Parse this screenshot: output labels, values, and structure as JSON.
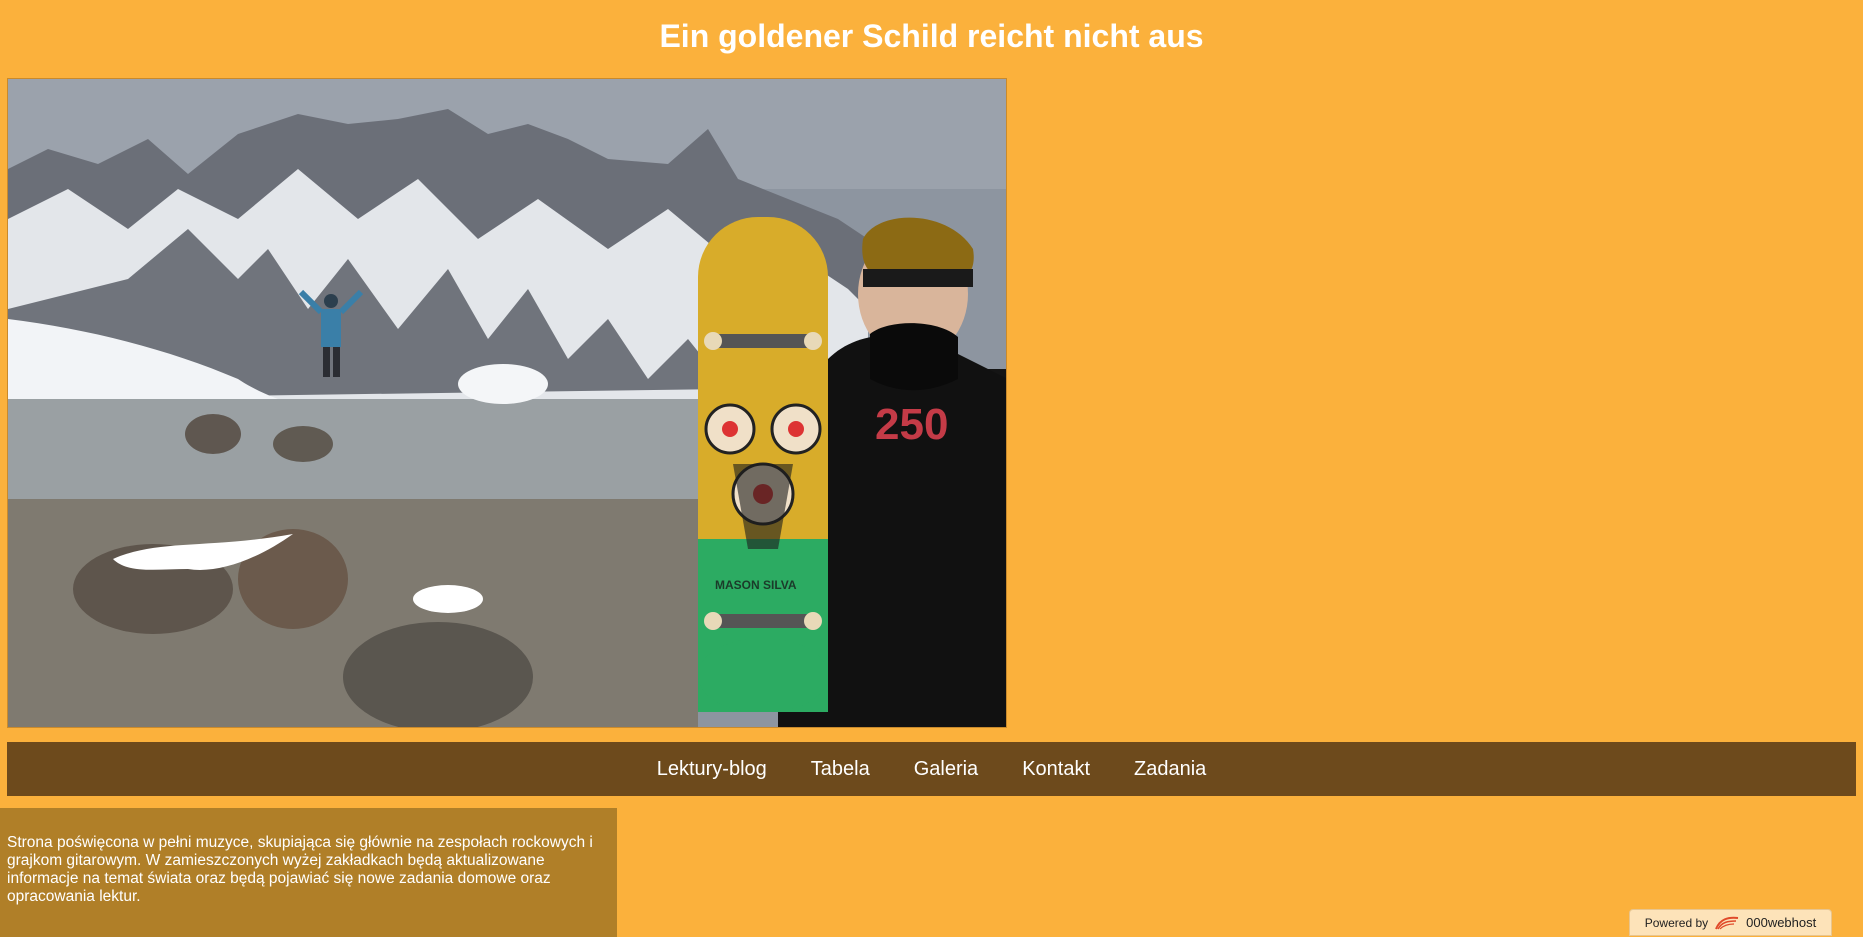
{
  "header": {
    "title": "Ein goldener Schild reicht nicht aus"
  },
  "hero": {
    "image": "mountain-lake-with-skater-collage",
    "deck_text": "MASON SILVA",
    "hoodie_text": "250"
  },
  "nav": {
    "items": [
      {
        "label": "Lektury-blog"
      },
      {
        "label": "Tabela"
      },
      {
        "label": "Galeria"
      },
      {
        "label": "Kontakt"
      },
      {
        "label": "Zadania"
      }
    ]
  },
  "about": {
    "text": "Strona poświęcona w pełni muzyce, skupiająca się głównie na zespołach rockowych i grajkom gitarowym. W zamieszczonych wyżej zakładkach będą aktualizowane informacje na temat świata oraz będą pojawiać się nowe zadania domowe oraz opracowania lektur."
  },
  "footer_badge": {
    "label": "Powered by",
    "brand": "000webhost"
  },
  "colors": {
    "page_bg": "#fbb13c",
    "nav_bg": "#6d4a1c",
    "about_bg": "#b07f28",
    "text": "#ffffff"
  }
}
